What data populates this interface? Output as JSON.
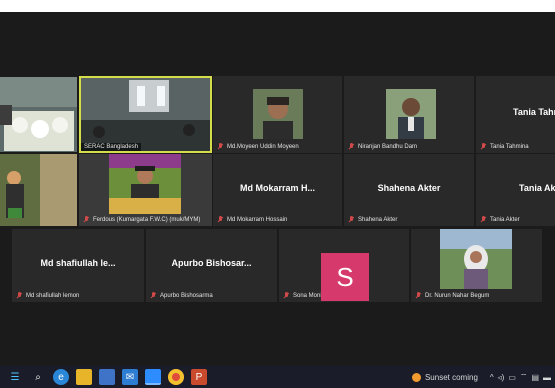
{
  "participants": [
    {
      "name": "SERAC Bangladesh",
      "muted": false,
      "video": true
    },
    {
      "name": "Md.Moyeen Uddin Moyeen",
      "muted": true,
      "video": true
    },
    {
      "name": "Niranjan Bandhu Dam",
      "muted": true,
      "video": true
    },
    {
      "name": "Tania Tahmina",
      "display": "Tania Tahm",
      "muted": true,
      "video": false
    },
    {
      "name": "Ferdous (Kumargata F.W.C) (muk/MYM)",
      "muted": true,
      "video": true
    },
    {
      "name": "Md Mokarram Hossain",
      "display": "Md Mokarram H...",
      "muted": true,
      "video": false
    },
    {
      "name": "Shahena Akter",
      "display": "Shahena Akter",
      "muted": true,
      "video": false
    },
    {
      "name": "Tania Akter",
      "display": "Tania Akt",
      "muted": true,
      "video": false
    },
    {
      "name": "Md shafiullah lemon",
      "display": "Md shafiullah le...",
      "muted": true,
      "video": false
    },
    {
      "name": "Apurbo Bishosarma",
      "display": "Apurbo Bishosar...",
      "muted": true,
      "video": false
    },
    {
      "name": "Sona Moni",
      "initial": "S",
      "muted": true,
      "video": false
    },
    {
      "name": "Dr. Nurun Nahar Begum",
      "muted": true,
      "video": true
    }
  ],
  "taskbar": {
    "weather": "Sunset coming",
    "icons": [
      "start-icon",
      "search-icon",
      "edge-icon",
      "file-explorer-icon",
      "store-icon",
      "mail-icon",
      "zoom-icon",
      "chrome-icon",
      "powerpoint-icon"
    ]
  },
  "colors": {
    "active_speaker": "#d6dd4a",
    "muted_mic": "#d04a4a",
    "avatar_s": "#d63a6c"
  }
}
